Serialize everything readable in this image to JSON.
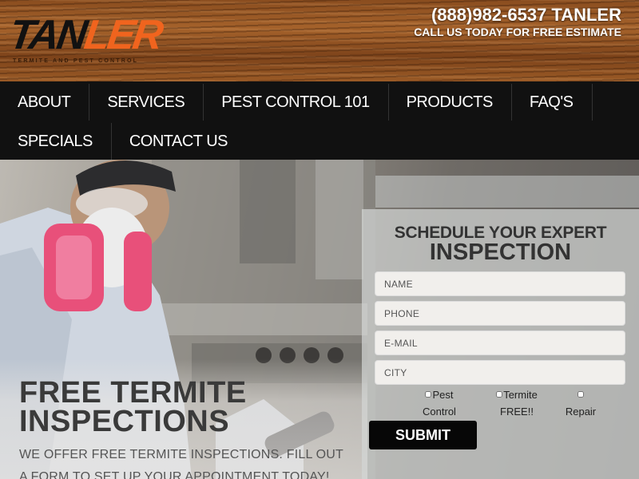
{
  "header": {
    "logo": {
      "part1": "TAN",
      "part2": "LER",
      "tagline": "TERMITE AND PEST CONTROL"
    },
    "phone": "(888)982-6537 TANLER",
    "call_text": "CALL US TODAY FOR FREE ESTIMATE"
  },
  "nav": {
    "row1": [
      "ABOUT",
      "SERVICES",
      "PEST CONTROL 101",
      "PRODUCTS",
      "FAQ'S"
    ],
    "row2": [
      "SPECIALS",
      "CONTACT US"
    ]
  },
  "hero": {
    "title_line1": "FREE TERMITE",
    "title_line2": "INSPECTIONS",
    "subtitle": "WE OFFER FREE TERMITE INSPECTIONS. FILL OUT A FORM TO SET UP YOUR APPOINTMENT TODAY!"
  },
  "form": {
    "title_line1": "SCHEDULE YOUR EXPERT",
    "title_line2": "INSPECTION",
    "fields": {
      "name": "NAME",
      "phone": "PHONE",
      "email": "E-MAIL",
      "city": "CITY"
    },
    "options": [
      {
        "line1": "Pest",
        "line2": "Control"
      },
      {
        "line1": "Termite",
        "line2": "FREE!!"
      },
      {
        "line1": "",
        "line2": "Repair"
      }
    ],
    "submit": "SUBMIT"
  },
  "colors": {
    "logo_accent": "#f0641e",
    "nav_bg": "#111111",
    "submit_bg": "#070707"
  }
}
